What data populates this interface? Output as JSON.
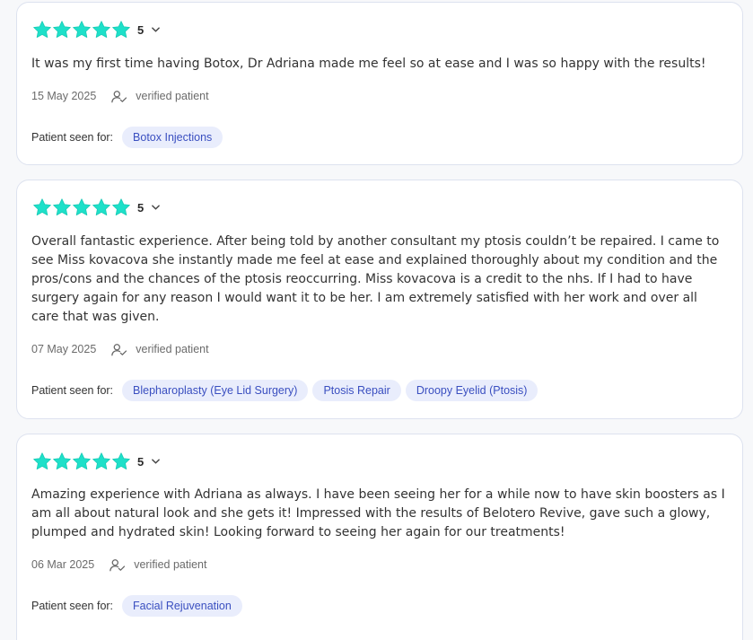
{
  "colors": {
    "star": "#1ee0c9",
    "tag_bg": "#e9edfc",
    "tag_text": "#3a4fc0"
  },
  "reviews": [
    {
      "rating": 5,
      "text": "It was my first time having Botox, Dr Adriana made me feel so at ease and I was so happy with the results!",
      "date": "15 May 2025",
      "verified": "verified patient",
      "seen_for_label": "Patient seen for:",
      "treatments": [
        "Botox Injections"
      ]
    },
    {
      "rating": 5,
      "text": "Overall fantastic experience. After being told by another consultant my ptosis couldn’t be repaired. I came to see Miss kovacova she instantly made me feel at ease and explained thoroughly about my condition and the pros/cons and the chances of the ptosis reoccurring. Miss kovacova is a credit to the nhs. If I had to have surgery again for any reason I would want it to be her. I am extremely satisfied with her work and over all care that was given.",
      "date": "07 May 2025",
      "verified": "verified patient",
      "seen_for_label": "Patient seen for:",
      "treatments": [
        "Blepharoplasty (Eye Lid Surgery)",
        "Ptosis Repair",
        "Droopy Eyelid (Ptosis)"
      ]
    },
    {
      "rating": 5,
      "text": "Amazing experience with Adriana as always. I have been seeing her for a while now to have skin boosters as I am all about natural look and she gets it! Impressed with the results of Belotero Revive, gave such a glowy, plumped and hydrated skin! Looking forward to seeing her again for our treatments!",
      "date": "06 Mar 2025",
      "verified": "verified patient",
      "seen_for_label": "Patient seen for:",
      "treatments": [
        "Facial Rejuvenation"
      ]
    }
  ]
}
